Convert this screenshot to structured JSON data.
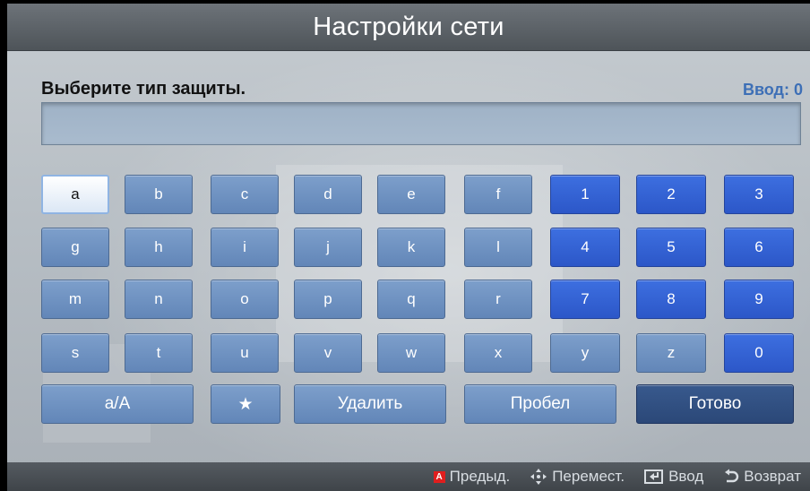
{
  "window": {
    "title": "Настройки сети"
  },
  "prompt": {
    "text": "Выберите тип защиты.",
    "counter": "Ввод: 0"
  },
  "input": {
    "value": ""
  },
  "keyboard": {
    "rows": [
      [
        "a",
        "b",
        "c",
        "d",
        "e",
        "f",
        "1",
        "2",
        "3"
      ],
      [
        "g",
        "h",
        "i",
        "j",
        "k",
        "l",
        "4",
        "5",
        "6"
      ],
      [
        "m",
        "n",
        "o",
        "p",
        "q",
        "r",
        "7",
        "8",
        "9"
      ],
      [
        "s",
        "t",
        "u",
        "v",
        "w",
        "x",
        "y",
        "z",
        "0"
      ]
    ],
    "selected_key": "a",
    "bottom": {
      "case_toggle": "a/A",
      "star": "★",
      "delete": "Удалить",
      "space": "Пробел",
      "done": "Готово"
    }
  },
  "footer": {
    "prev_badge": "A",
    "prev": "Предыд.",
    "move": "Перемест.",
    "enter": "Ввод",
    "back": "Возврат"
  },
  "colors": {
    "title_bar": "#555b61",
    "letter_key": "#6f92c2",
    "digit_key": "#3461d4",
    "selected_key": "#ffffff",
    "done_key": "#2f4d80",
    "counter_text": "#3d6fb6",
    "red_badge": "#e01e1e"
  }
}
